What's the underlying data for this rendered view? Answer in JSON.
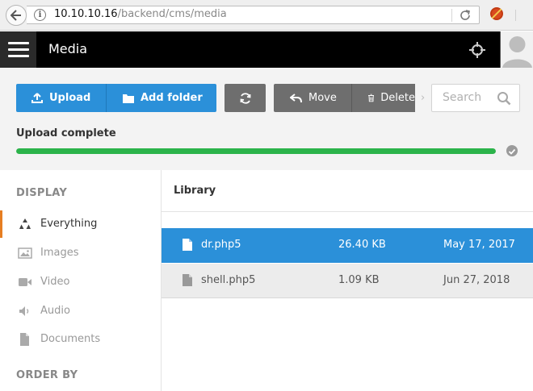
{
  "browser": {
    "url_host": "10.10.10.16",
    "url_path": "/backend/cms/media"
  },
  "header": {
    "title": "Media"
  },
  "toolbar": {
    "upload_label": "Upload",
    "add_folder_label": "Add folder",
    "move_label": "Move",
    "delete_label": "Delete",
    "search_placeholder": "Search"
  },
  "upload": {
    "status_text": "Upload complete",
    "progress_percent": 100,
    "progress_color": "#2bb34a"
  },
  "sidebar": {
    "display_heading": "DISPLAY",
    "items": [
      {
        "label": "Everything",
        "icon": "recycle-icon",
        "active": true
      },
      {
        "label": "Images",
        "icon": "image-icon",
        "active": false
      },
      {
        "label": "Video",
        "icon": "video-icon",
        "active": false
      },
      {
        "label": "Audio",
        "icon": "volume-icon",
        "active": false
      },
      {
        "label": "Documents",
        "icon": "document-icon",
        "active": false
      }
    ],
    "order_heading": "ORDER BY"
  },
  "library": {
    "title": "Library",
    "files": [
      {
        "name": "dr.php5",
        "size": "26.40 KB",
        "date": "May 17, 2017",
        "selected": true
      },
      {
        "name": "shell.php5",
        "size": "1.09 KB",
        "date": "Jun 27, 2018",
        "selected": false
      }
    ]
  },
  "colors": {
    "accent_blue": "#2b90d9",
    "active_marker": "#e67e22",
    "header_bg": "#000000"
  }
}
